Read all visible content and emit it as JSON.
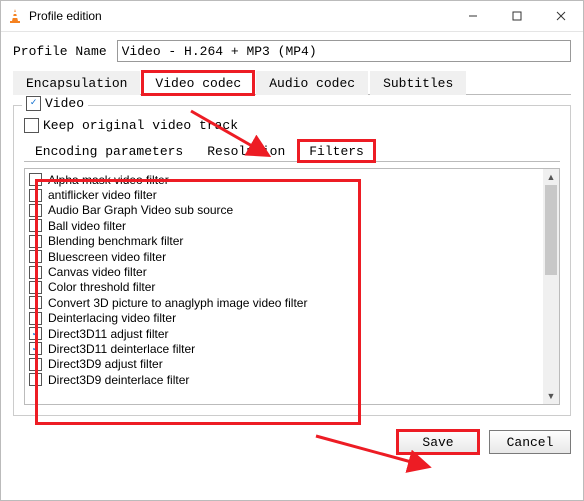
{
  "window": {
    "title": "Profile edition"
  },
  "profile": {
    "label": "Profile Name",
    "value": "Video - H.264 + MP3 (MP4)"
  },
  "outer_tabs": {
    "encapsulation": "Encapsulation",
    "video_codec": "Video codec",
    "audio_codec": "Audio codec",
    "subtitles": "Subtitles"
  },
  "video_group": {
    "video_label": "Video",
    "keep_original": "Keep original video track"
  },
  "inner_tabs": {
    "encoding": "Encoding parameters",
    "resolution": "Resolution",
    "filters": "Filters"
  },
  "filters": [
    {
      "label": "Alpha mask video filter",
      "checked": false
    },
    {
      "label": "antiflicker video filter",
      "checked": false
    },
    {
      "label": "Audio Bar Graph Video sub source",
      "checked": false
    },
    {
      "label": "Ball video filter",
      "checked": false
    },
    {
      "label": "Blending benchmark filter",
      "checked": false
    },
    {
      "label": "Bluescreen video filter",
      "checked": false
    },
    {
      "label": "Canvas video filter",
      "checked": false
    },
    {
      "label": "Color threshold filter",
      "checked": false
    },
    {
      "label": "Convert 3D picture to anaglyph image video filter",
      "checked": false
    },
    {
      "label": "Deinterlacing video filter",
      "checked": false
    },
    {
      "label": "Direct3D11 adjust filter",
      "checked": true
    },
    {
      "label": "Direct3D11 deinterlace filter",
      "checked": true
    },
    {
      "label": "Direct3D9 adjust filter",
      "checked": false
    },
    {
      "label": "Direct3D9 deinterlace filter",
      "checked": false
    }
  ],
  "buttons": {
    "save": "Save",
    "cancel": "Cancel"
  }
}
